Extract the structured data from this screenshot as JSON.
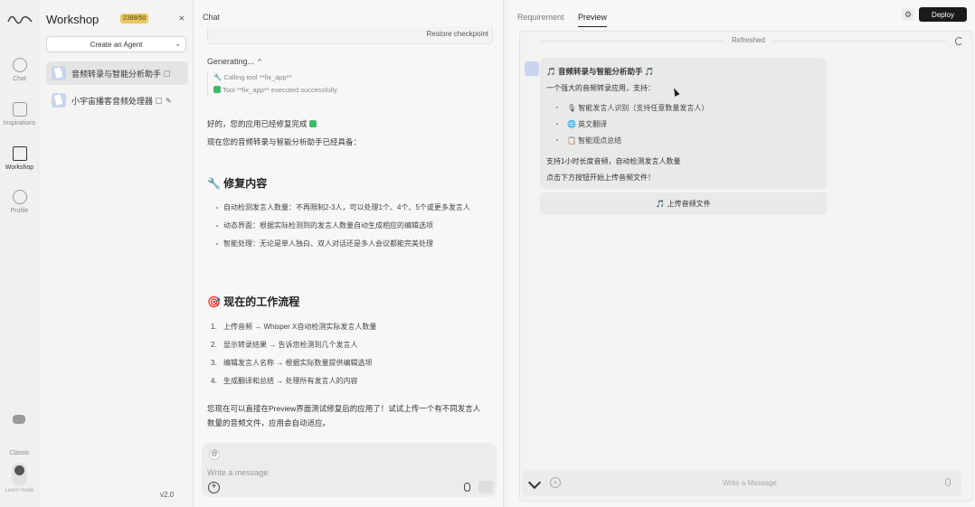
{
  "rail": {
    "items": [
      {
        "label": "Chat",
        "icon": "chat-icon"
      },
      {
        "label": "Inspirations",
        "icon": "inspiration-icon"
      },
      {
        "label": "Workshop",
        "icon": "workshop-icon"
      },
      {
        "label": "Profile",
        "icon": "profile-icon"
      }
    ],
    "classic_label": "Classic",
    "learn_label": "Learn mode"
  },
  "sidebar": {
    "title": "Workshop",
    "credits": "2389/50",
    "collapse_icon": "collapse-icon",
    "create_label": "Create an Agent",
    "agents": [
      {
        "name": "音频转录与智能分析助手"
      },
      {
        "name": "小宇宙播客音频处理器"
      }
    ],
    "version": "v2.0"
  },
  "chat": {
    "title": "Chat",
    "restore_label": "Restore checkpoint",
    "generating_label": "Generating...",
    "tool_calls": [
      "Calling tool **fix_app**",
      "Tool **fix_app** executed successfully"
    ],
    "intro1": "好的，您的应用已经修复完成",
    "intro2": "现在您的音频转录与智能分析助手已经具备：",
    "fix_heading": "🔧 修复内容",
    "fix_items": [
      "自动检测发言人数量：不再限制2-3人，可以处理1个、4个、5个或更多发言人",
      "动态界面：根据实际检测到的发言人数量自动生成相应的编辑选项",
      "智能处理：无论是单人独白、双人对话还是多人会议都能完美处理"
    ],
    "workflow_heading": "🎯 现在的工作流程",
    "workflow_items": [
      {
        "n": "1.",
        "text": "上传音频 → Whisper X自动检测实际发言人数量"
      },
      {
        "n": "2.",
        "text": "显示转录结果 → 告诉您检测到几个发言人"
      },
      {
        "n": "3.",
        "text": "编辑发言人名称 → 根据实际数量提供编辑选项"
      },
      {
        "n": "4.",
        "text": "生成翻译和总结 → 处理所有发言人的内容"
      }
    ],
    "outro1": "您现在可以直接在Preview界面测试修复后的应用了！试试上传一个有不同发言人",
    "outro2": "数量的音频文件，应用会自动适应。",
    "composer_placeholder": "Write a message"
  },
  "preview": {
    "tabs": [
      {
        "label": "Requirement",
        "active": false
      },
      {
        "label": "Preview",
        "active": true
      }
    ],
    "deploy_label": "Deploy",
    "refreshed_label": "Refreshed",
    "card": {
      "title": "🎵 音频转录与智能分析助手 🎵",
      "subtitle": "一个强大的音频转录应用，支持：",
      "features": [
        "🎙 智能发言人识别（支持任意数量发言人）",
        "🌐 英文翻译",
        "📋 智能观点总结"
      ],
      "note1": "支持1小时长度音频，自动检测发言人数量",
      "note2": "点击下方按钮开始上传音频文件！"
    },
    "upload_label": "🎵 上传音频文件",
    "composer_placeholder": "Write a Message"
  },
  "colors": {
    "accent_dark": "#1a1a1a",
    "credit_gold": "#e8c765",
    "success": "#3dbb6a"
  }
}
